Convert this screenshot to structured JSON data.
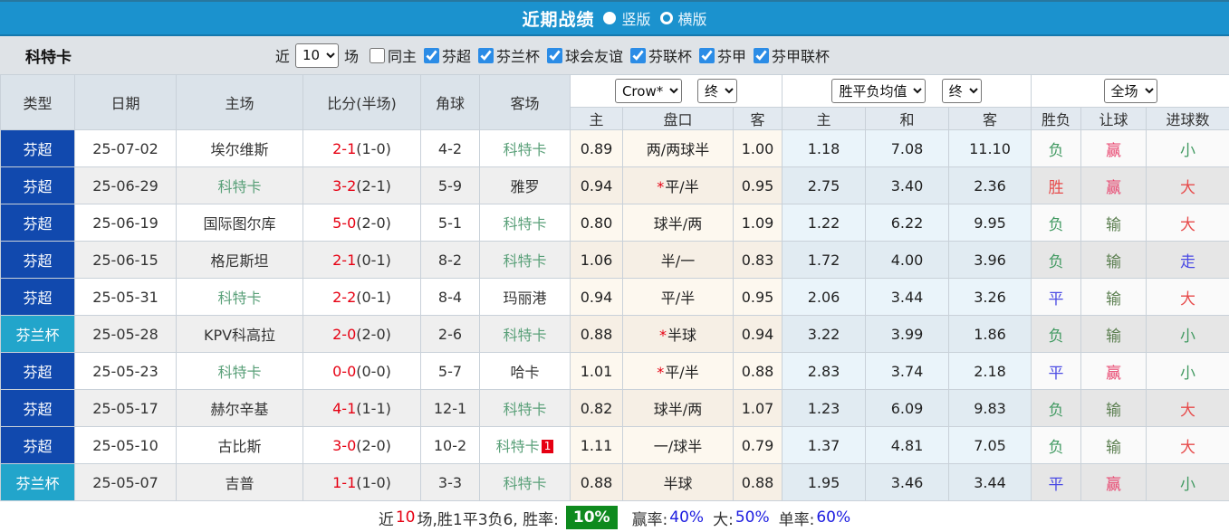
{
  "titlebar": {
    "title": "近期战绩",
    "vertical_label": "竖版",
    "horizontal_label": "横版"
  },
  "filterbar": {
    "team": "科特卡",
    "near_label": "近",
    "near_value": "10",
    "games_label": "场",
    "same_venue_label": "同主",
    "leagues": [
      "芬超",
      "芬兰杯",
      "球会友谊",
      "芬联杯",
      "芬甲",
      "芬甲联杯"
    ]
  },
  "table": {
    "headers_left": [
      "类型",
      "日期",
      "主场",
      "比分(半场)",
      "角球",
      "客场"
    ],
    "dropdowns": {
      "company": "Crow*",
      "company_time": "终",
      "avg": "胜平负均值",
      "avg_time": "终",
      "scope": "全场"
    },
    "subheaders": [
      "主",
      "盘口",
      "客",
      "主",
      "和",
      "客",
      "胜负",
      "让球",
      "进球数"
    ],
    "rows": [
      {
        "type": "芬超",
        "league": "super",
        "date": "25-07-02",
        "home": "埃尔维斯",
        "home_focus": false,
        "score": "2-1",
        "half": "(1-0)",
        "corner": "4-2",
        "away": "科特卡",
        "away_focus": true,
        "red_card": false,
        "odds_home": "0.89",
        "handicap": "两/两球半",
        "handicap_star": false,
        "odds_away": "1.00",
        "avg_win": "1.18",
        "avg_draw": "7.08",
        "avg_lose": "11.10",
        "res_wdl": [
          "负",
          "g"
        ],
        "res_let": [
          "赢",
          "c"
        ],
        "res_goal": [
          "小",
          "g"
        ]
      },
      {
        "type": "芬超",
        "league": "super",
        "date": "25-06-29",
        "home": "科特卡",
        "home_focus": true,
        "score": "3-2",
        "half": "(2-1)",
        "corner": "5-9",
        "away": "雅罗",
        "away_focus": false,
        "red_card": false,
        "odds_home": "0.94",
        "handicap": "平/半",
        "handicap_star": true,
        "odds_away": "0.95",
        "avg_win": "2.75",
        "avg_draw": "3.40",
        "avg_lose": "2.36",
        "res_wdl": [
          "胜",
          "r"
        ],
        "res_let": [
          "赢",
          "c"
        ],
        "res_goal": [
          "大",
          "r"
        ]
      },
      {
        "type": "芬超",
        "league": "super",
        "date": "25-06-19",
        "home": "国际图尔库",
        "home_focus": false,
        "score": "5-0",
        "half": "(2-0)",
        "corner": "5-1",
        "away": "科特卡",
        "away_focus": true,
        "red_card": false,
        "odds_home": "0.80",
        "handicap": "球半/两",
        "handicap_star": false,
        "odds_away": "1.09",
        "avg_win": "1.22",
        "avg_draw": "6.22",
        "avg_lose": "9.95",
        "res_wdl": [
          "负",
          "g"
        ],
        "res_let": [
          "输",
          "dg"
        ],
        "res_goal": [
          "大",
          "r"
        ]
      },
      {
        "type": "芬超",
        "league": "super",
        "date": "25-06-15",
        "home": "格尼斯坦",
        "home_focus": false,
        "score": "2-1",
        "half": "(0-1)",
        "corner": "8-2",
        "away": "科特卡",
        "away_focus": true,
        "red_card": false,
        "odds_home": "1.06",
        "handicap": "半/一",
        "handicap_star": false,
        "odds_away": "0.83",
        "avg_win": "1.72",
        "avg_draw": "4.00",
        "avg_lose": "3.96",
        "res_wdl": [
          "负",
          "g"
        ],
        "res_let": [
          "输",
          "dg"
        ],
        "res_goal": [
          "走",
          "b"
        ]
      },
      {
        "type": "芬超",
        "league": "super",
        "date": "25-05-31",
        "home": "科特卡",
        "home_focus": true,
        "score": "2-2",
        "half": "(0-1)",
        "corner": "8-4",
        "away": "玛丽港",
        "away_focus": false,
        "red_card": false,
        "odds_home": "0.94",
        "handicap": "平/半",
        "handicap_star": false,
        "odds_away": "0.95",
        "avg_win": "2.06",
        "avg_draw": "3.44",
        "avg_lose": "3.26",
        "res_wdl": [
          "平",
          "b"
        ],
        "res_let": [
          "输",
          "dg"
        ],
        "res_goal": [
          "大",
          "r"
        ]
      },
      {
        "type": "芬兰杯",
        "league": "cup",
        "date": "25-05-28",
        "home": "KPV科高拉",
        "home_focus": false,
        "score": "2-0",
        "half": "(2-0)",
        "corner": "2-6",
        "away": "科特卡",
        "away_focus": true,
        "red_card": false,
        "odds_home": "0.88",
        "handicap": "半球",
        "handicap_star": true,
        "odds_away": "0.94",
        "avg_win": "3.22",
        "avg_draw": "3.99",
        "avg_lose": "1.86",
        "res_wdl": [
          "负",
          "g"
        ],
        "res_let": [
          "输",
          "dg"
        ],
        "res_goal": [
          "小",
          "g"
        ]
      },
      {
        "type": "芬超",
        "league": "super",
        "date": "25-05-23",
        "home": "科特卡",
        "home_focus": true,
        "score": "0-0",
        "half": "(0-0)",
        "corner": "5-7",
        "away": "哈卡",
        "away_focus": false,
        "red_card": false,
        "odds_home": "1.01",
        "handicap": "平/半",
        "handicap_star": true,
        "odds_away": "0.88",
        "avg_win": "2.83",
        "avg_draw": "3.74",
        "avg_lose": "2.18",
        "res_wdl": [
          "平",
          "b"
        ],
        "res_let": [
          "赢",
          "c"
        ],
        "res_goal": [
          "小",
          "g"
        ]
      },
      {
        "type": "芬超",
        "league": "super",
        "date": "25-05-17",
        "home": "赫尔辛基",
        "home_focus": false,
        "score": "4-1",
        "half": "(1-1)",
        "corner": "12-1",
        "away": "科特卡",
        "away_focus": true,
        "red_card": false,
        "odds_home": "0.82",
        "handicap": "球半/两",
        "handicap_star": false,
        "odds_away": "1.07",
        "avg_win": "1.23",
        "avg_draw": "6.09",
        "avg_lose": "9.83",
        "res_wdl": [
          "负",
          "g"
        ],
        "res_let": [
          "输",
          "dg"
        ],
        "res_goal": [
          "大",
          "r"
        ]
      },
      {
        "type": "芬超",
        "league": "super",
        "date": "25-05-10",
        "home": "古比斯",
        "home_focus": false,
        "score": "3-0",
        "half": "(2-0)",
        "corner": "10-2",
        "away": "科特卡",
        "away_focus": true,
        "red_card": true,
        "odds_home": "1.11",
        "handicap": "一/球半",
        "handicap_star": false,
        "odds_away": "0.79",
        "avg_win": "1.37",
        "avg_draw": "4.81",
        "avg_lose": "7.05",
        "res_wdl": [
          "负",
          "g"
        ],
        "res_let": [
          "输",
          "dg"
        ],
        "res_goal": [
          "大",
          "r"
        ]
      },
      {
        "type": "芬兰杯",
        "league": "cup",
        "date": "25-05-07",
        "home": "吉普",
        "home_focus": false,
        "score": "1-1",
        "half": "(1-0)",
        "corner": "3-3",
        "away": "科特卡",
        "away_focus": true,
        "red_card": false,
        "odds_home": "0.88",
        "handicap": "半球",
        "handicap_star": false,
        "odds_away": "0.88",
        "avg_win": "1.95",
        "avg_draw": "3.46",
        "avg_lose": "3.44",
        "res_wdl": [
          "平",
          "b"
        ],
        "res_let": [
          "赢",
          "c"
        ],
        "res_goal": [
          "小",
          "g"
        ]
      }
    ]
  },
  "summary": {
    "recent_label": "近",
    "recent_count": "10",
    "stats_text": "场,胜1平3负6, 胜率:",
    "win_rate": "10%",
    "wl_label": "赢率:",
    "wl_value": "40%",
    "big_label": "大:",
    "big_value": "50%",
    "single_label": "单率:",
    "single_value": "60%"
  }
}
